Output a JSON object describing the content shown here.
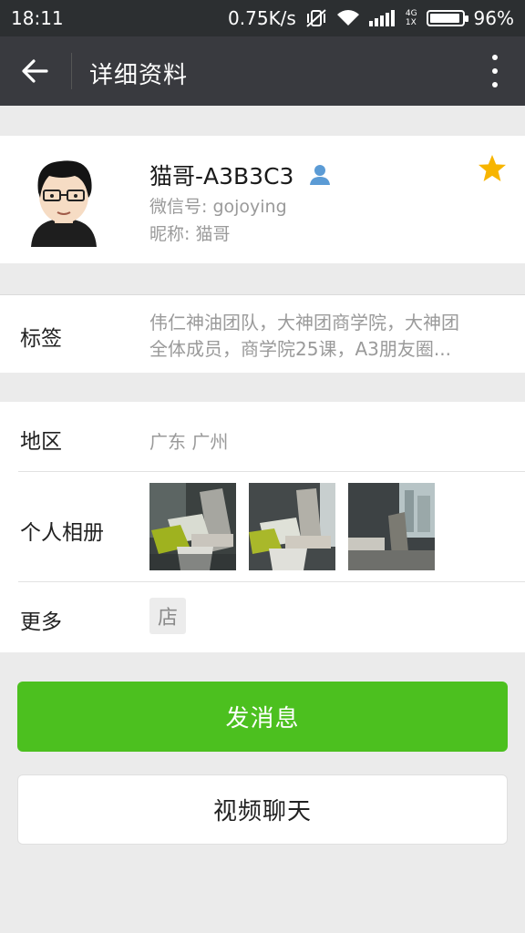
{
  "status_bar": {
    "time": "18:11",
    "network_speed": "0.75K/s",
    "network_type_top": "4G",
    "network_type_bottom": "1X",
    "battery": "96%",
    "battery_level": 0.96
  },
  "app_bar": {
    "title": "详细资料"
  },
  "profile": {
    "name": "猫哥-A3B3C3",
    "wechat_id": "微信号: gojoying",
    "nickname": "昵称: 猫哥",
    "starred": true
  },
  "tags": {
    "label": "标签",
    "line1": "伟仁神油团队，大神团商学院，大神团",
    "line2": "全体成员，商学院25课，A3朋友圈..."
  },
  "info": {
    "region_label": "地区",
    "region_value": "广东  广州",
    "album_label": "个人相册",
    "more_label": "更多",
    "shop_icon_text": "店"
  },
  "actions": {
    "message_label": "发消息",
    "video_label": "视频聊天"
  },
  "colors": {
    "primary_green": "#4cc01f",
    "app_bar": "#393a3f",
    "star": "#f7b500",
    "contact_badge": "#5b9bd5"
  }
}
